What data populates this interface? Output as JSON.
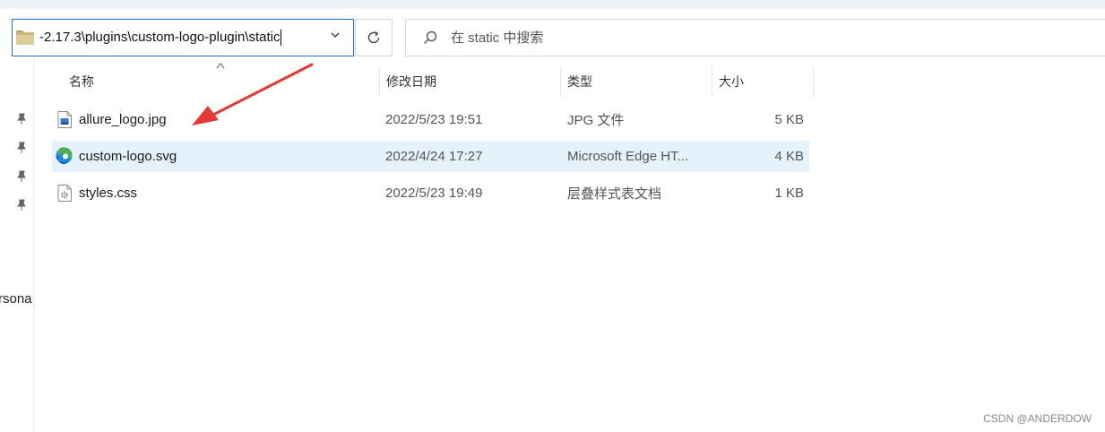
{
  "address_bar": {
    "path": "-2.17.3\\plugins\\custom-logo-plugin\\static"
  },
  "search": {
    "placeholder": "在 static 中搜索"
  },
  "nav": {
    "partial_label": "rsona"
  },
  "columns": {
    "name": "名称",
    "date": "修改日期",
    "type": "类型",
    "size": "大小"
  },
  "files": [
    {
      "name": "allure_logo.jpg",
      "date": "2022/5/23 19:51",
      "type": "JPG 文件",
      "size": "5 KB",
      "icon": "image-file-icon",
      "selected": false
    },
    {
      "name": "custom-logo.svg",
      "date": "2022/4/24 17:27",
      "type": "Microsoft Edge HT...",
      "size": "4 KB",
      "icon": "edge-browser-icon",
      "selected": true
    },
    {
      "name": "styles.css",
      "date": "2022/5/23 19:49",
      "type": "层叠样式表文档",
      "size": "1 KB",
      "icon": "css-file-icon",
      "selected": false
    }
  ],
  "colors": {
    "accent": "#1f6fd1",
    "selection": "#e5f1fb",
    "annotation": "#e53935"
  },
  "watermark": "CSDN @ANDERDOW"
}
